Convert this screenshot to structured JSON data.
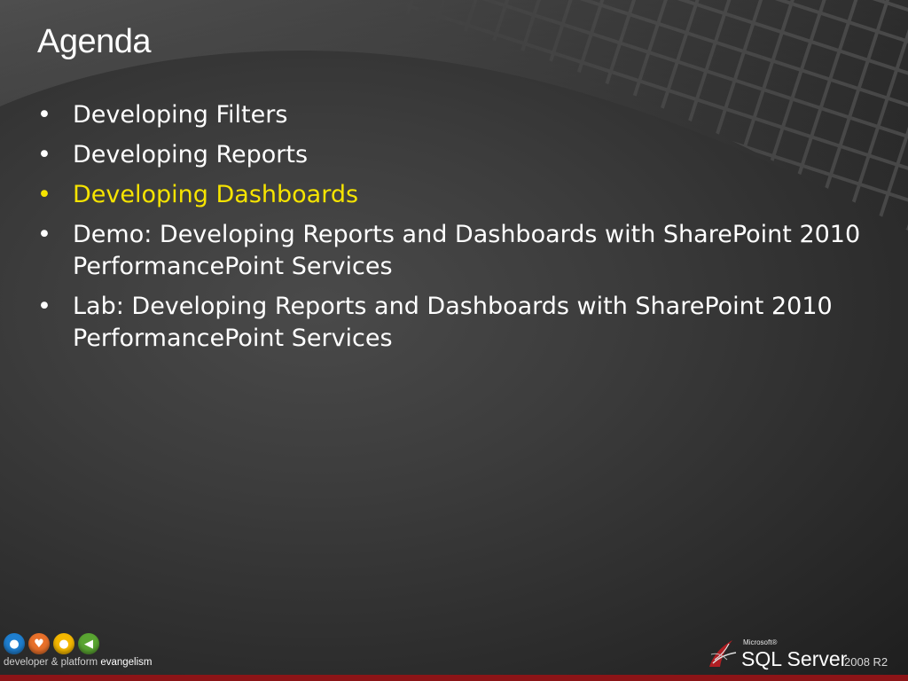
{
  "slide": {
    "title": "Agenda",
    "items": [
      {
        "bullet": "•",
        "text": "Developing Filters",
        "highlighted": false
      },
      {
        "bullet": "•",
        "text": "Developing Reports",
        "highlighted": false
      },
      {
        "bullet": "•",
        "text": "Developing Dashboards",
        "highlighted": true
      },
      {
        "bullet": "•",
        "text": "Demo: Developing Reports and Dashboards with SharePoint 2010 PerformancePoint Services",
        "highlighted": false
      },
      {
        "bullet": "•",
        "text": "Lab: Developing Reports and Dashboards with SharePoint 2010 PerformancePoint Services",
        "highlighted": false
      }
    ]
  },
  "footer": {
    "dpe": {
      "icons": [
        "person-icon",
        "heart-icon",
        "lightbulb-icon",
        "megaphone-icon"
      ],
      "icon_colors": [
        "#1f7fd0",
        "#e8702a",
        "#f5b800",
        "#5aa532"
      ],
      "text_prefix": "developer & platform ",
      "text_strong": "evangelism"
    },
    "sql_logo": {
      "microsoft": "Microsoft®",
      "product": "SQL Server",
      "version": "2008 R2"
    }
  },
  "colors": {
    "background": "#3a3a3a",
    "title_text": "#ffffff",
    "body_text": "#ffffff",
    "highlight_text": "#f6e400",
    "bottom_bar": "#8c1417"
  }
}
